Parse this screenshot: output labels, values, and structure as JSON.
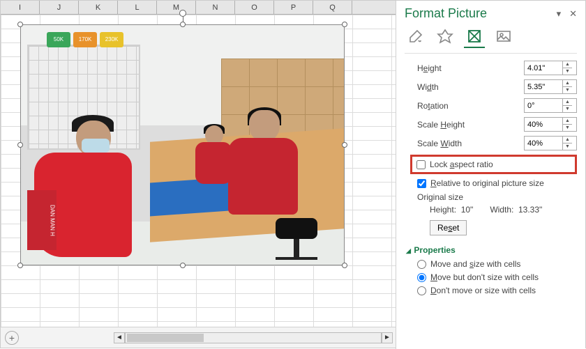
{
  "columns": [
    "I",
    "J",
    "K",
    "L",
    "M",
    "N",
    "O",
    "P",
    "Q"
  ],
  "panel": {
    "title": "Format Picture",
    "close_symbol": "▾",
    "x_symbol": "✕",
    "tabs": {
      "fill": "fill-icon",
      "effects": "effects-icon",
      "size": "size-icon",
      "picture": "picture-icon"
    },
    "size": {
      "height_label": "Height",
      "height_value": "4.01\"",
      "width_label": "Width",
      "width_value": "5.35\"",
      "rotation_label": "Rotation",
      "rotation_value": "0°",
      "scale_h_label": "Scale Height",
      "scale_h_value": "40%",
      "scale_w_label": "Scale Width",
      "scale_w_value": "40%",
      "lock_label": "Lock aspect ratio",
      "lock_checked": false,
      "relative_label": "Relative to original picture size",
      "relative_checked": true,
      "original_label": "Original size",
      "orig_h_label": "Height:",
      "orig_h_value": "10\"",
      "orig_w_label": "Width:",
      "orig_w_value": "13.33\"",
      "reset_label": "Reset"
    },
    "props": {
      "title": "Properties",
      "opt1": "Move and size with cells",
      "opt2": "Move but don't size with cells",
      "opt3": "Don't move or size with cells",
      "selected": "opt2"
    }
  },
  "image_signs": [
    "50K",
    "170K",
    "230K"
  ],
  "image_banner": "DAN MAN H"
}
